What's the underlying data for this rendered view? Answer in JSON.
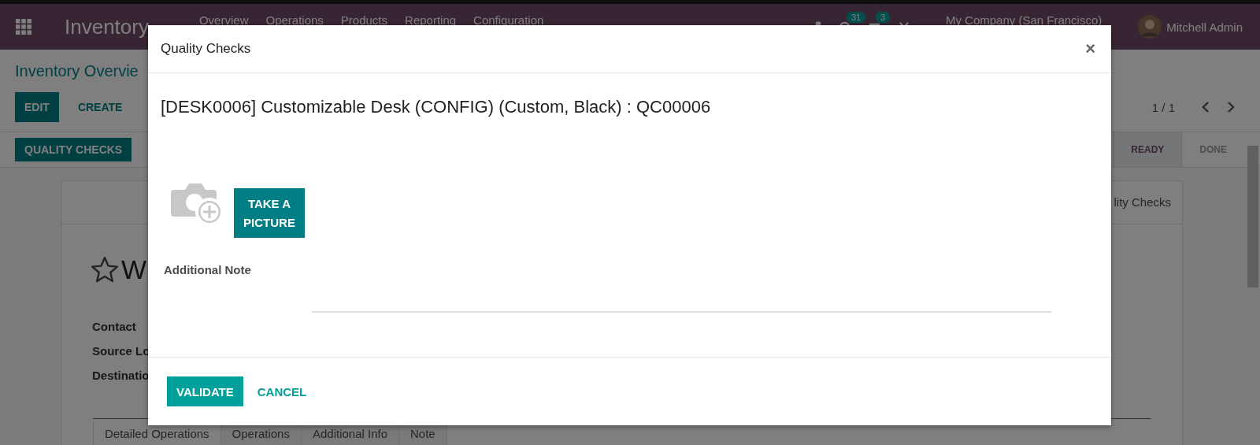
{
  "navbar": {
    "app_name": "Inventory",
    "menu": [
      "Overview",
      "Operations",
      "Products",
      "Reporting",
      "Configuration"
    ],
    "activity_count": "31",
    "message_count": "3",
    "company": "My Company (San Francisco)",
    "user": "Mitchell Admin"
  },
  "breadcrumb": "Inventory Overvie",
  "actions": [
    {
      "label": "EDIT",
      "kind": "primary"
    },
    {
      "label": "CREATE",
      "kind": "link"
    }
  ],
  "pager": "1 / 1",
  "header_buttons": [
    "QUALITY CHECKS"
  ],
  "statusbar": [
    {
      "label": "READY",
      "selected": true
    },
    {
      "label": "DONE",
      "selected": false
    }
  ],
  "form": {
    "smart_button": "lity Checks",
    "starred": false,
    "title": "W",
    "fields": [
      "Contact",
      "Source Lo",
      "Destinatio"
    ],
    "tabs": [
      {
        "label": "Detailed Operations",
        "selected": true
      },
      {
        "label": "Operations",
        "selected": false
      },
      {
        "label": "Additional Info",
        "selected": false
      },
      {
        "label": "Note",
        "selected": false
      }
    ]
  },
  "dialog": {
    "title": "Quality Checks",
    "close": "×",
    "heading": "[DESK0006] Customizable Desk (CONFIG) (Custom, Black) : QC00006",
    "picture_button": "TAKE A PICTURE",
    "note_label": "Additional Note",
    "buttons": [
      {
        "label": "VALIDATE",
        "kind": "primary"
      },
      {
        "label": "CANCEL",
        "kind": "link"
      }
    ]
  }
}
